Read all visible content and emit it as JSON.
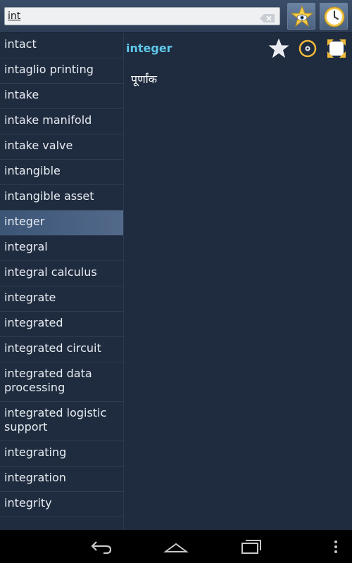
{
  "search": {
    "value": "int",
    "clear_icon": "backspace-icon"
  },
  "toolbar": {
    "favorites_icon": "star-eye-icon",
    "history_icon": "clock-icon"
  },
  "wordlist": [
    "intact",
    "intaglio printing",
    "intake",
    "intake manifold",
    "intake valve",
    "intangible",
    "intangible asset",
    "integer",
    "integral",
    "integral calculus",
    "integrate",
    "integrated",
    "integrated circuit",
    "integrated data processing",
    "integrated logistic support",
    "integrating",
    "integration",
    "integrity"
  ],
  "selected_index": 7,
  "detail": {
    "headword": "integer",
    "translation": "पूर्णांक",
    "star_icon": "star-icon",
    "speaker_icon": "speaker-icon",
    "expand_icon": "expand-icon"
  },
  "colors": {
    "background": "#1f2c3f",
    "headword": "#5fc8ea",
    "selected_row": "#4b6283"
  }
}
